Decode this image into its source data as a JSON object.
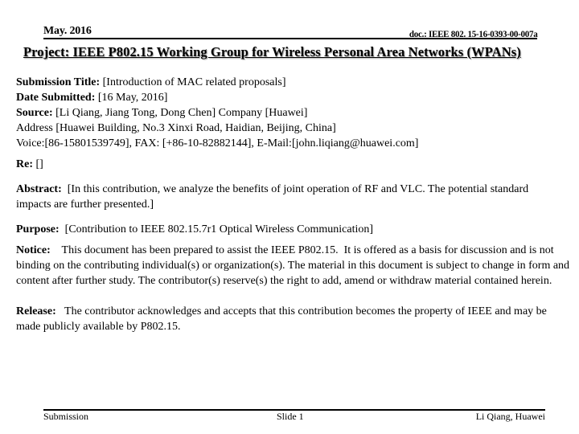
{
  "header": {
    "date": "May. 2016",
    "doc_id": "doc.: IEEE 802. 15-16-0393-00-007a",
    "project_title": "Project: IEEE P802.15 Working Group for Wireless Personal Area Networks (WPANs)"
  },
  "fields": {
    "submission_title": {
      "label": "Submission Title:",
      "value": " [Introduction of MAC related proposals]"
    },
    "date_submitted": {
      "label": "Date Submitted:",
      "value": " [16 May, 2016]"
    },
    "source": {
      "label": "Source:",
      "value": " [Li Qiang, Jiang Tong, Dong Chen] Company [Huawei]"
    },
    "address": "Address [Huawei Building, No.3 Xinxi Road, Haidian, Beijing, China]",
    "voice": "Voice:[86-15801539749], FAX: [+86-10-82882144], E-Mail:[john.liqiang@huawei.com]",
    "re": {
      "label": "Re:",
      "value": " []"
    },
    "abstract": {
      "label": "Abstract:",
      "value": "  [In this contribution, we analyze the benefits of joint operation of RF and VLC. The potential standard impacts are further presented.]"
    },
    "purpose": {
      "label": "Purpose:",
      "value": "  [Contribution to IEEE 802.15.7r1 Optical Wireless Communication]"
    },
    "notice": {
      "label": "Notice:",
      "value": "    This document has been prepared to assist the IEEE P802.15.  It is offered as a basis for discussion and is not binding on the contributing individual(s) or organization(s). The material in this document is subject to change in form and content after further study. The contributor(s) reserve(s) the right to add, amend or withdraw material contained herein."
    },
    "release": {
      "label": "Release:",
      "value": "   The contributor acknowledges and accepts that this contribution becomes the property of IEEE and may be made publicly available by P802.15."
    }
  },
  "footer": {
    "left": "Submission",
    "center": "Slide 1",
    "right": "Li Qiang, Huawei"
  }
}
